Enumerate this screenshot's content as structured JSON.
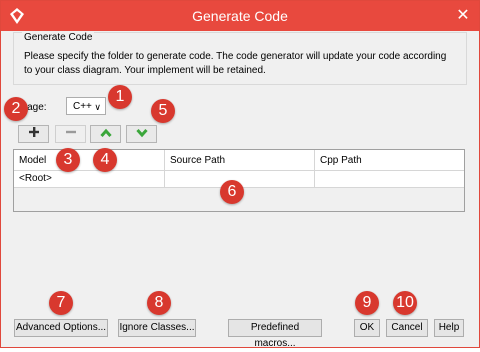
{
  "window": {
    "title": "Generate Code",
    "close_glyph": "✕",
    "app_icon": "diamond-logo-icon",
    "title_color": "#e8493e"
  },
  "group": {
    "title": "Generate Code",
    "description": "Please specify the folder to generate code. The code generator will update your code according to your class diagram. Your implement will be retained."
  },
  "language": {
    "label": "guage:",
    "value": "C++"
  },
  "toolbar": {
    "add_icon": "plus-icon",
    "remove_icon": "minus-icon",
    "up_icon": "arrow-up-icon",
    "down_icon": "arrow-down-icon"
  },
  "table": {
    "columns": [
      "Model",
      "Source Path",
      "Cpp Path"
    ],
    "rows": [
      [
        "<Root>",
        "",
        ""
      ]
    ]
  },
  "buttons": {
    "advanced": "Advanced Options...",
    "ignore": "Ignore Classes...",
    "macros": "Predefined macros...",
    "ok": "OK",
    "cancel": "Cancel",
    "help": "Help"
  },
  "callouts": [
    "1",
    "2",
    "3",
    "4",
    "5",
    "6",
    "7",
    "8",
    "9",
    "10"
  ],
  "colors": {
    "callout": "#d8382e",
    "arrow_green": "#3aa63a"
  }
}
